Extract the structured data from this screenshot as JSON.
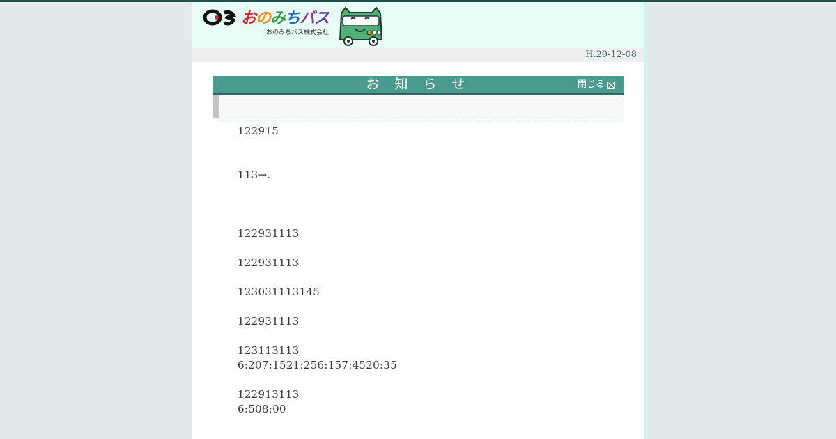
{
  "header": {
    "logo_title_chars": [
      "お",
      "の",
      "み",
      "ち",
      "バ",
      "ス"
    ],
    "company_name": "おのみちバス株式会社",
    "date": "H.29-12-08"
  },
  "notice": {
    "title": "お 知 ら せ",
    "close_label": "閉じる"
  },
  "content": {
    "line1": "122915",
    "line2": "113→.",
    "line3": "122931113",
    "line4": "122931113",
    "line5": "123031113145",
    "line6": "122931113",
    "line7a": "123113113",
    "line7b": "6:207:1521:256:157:4520:35",
    "line8a": "122913113",
    "line8b": "6:508:00"
  },
  "colors": {
    "outer_background": "#e2ebe9",
    "header_background": "#e9fdf7",
    "notice_bar": "#4a9a8f",
    "mascot_green": "#4fb07a"
  }
}
